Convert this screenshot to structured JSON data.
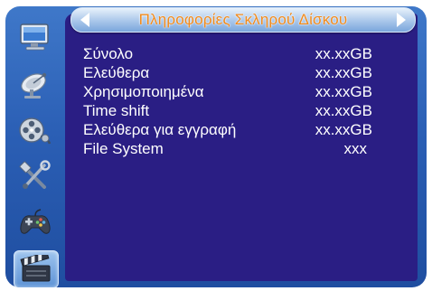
{
  "window": {
    "title": "Πληροφορίες Σκληρού Δίσκου"
  },
  "sidebar": {
    "items": [
      {
        "icon": "computer-monitor-icon",
        "selected": false
      },
      {
        "icon": "satellite-dish-icon",
        "selected": false
      },
      {
        "icon": "film-reel-icon",
        "selected": false
      },
      {
        "icon": "tools-icon",
        "selected": false
      },
      {
        "icon": "gamepad-icon",
        "selected": false
      },
      {
        "icon": "clapperboard-icon",
        "selected": true
      }
    ]
  },
  "info": {
    "rows": [
      {
        "label": "Σύνολο",
        "value": "xx.xxGB"
      },
      {
        "label": "Ελεύθερα",
        "value": "xx.xxGB"
      },
      {
        "label": "Χρησιμοποιημένα",
        "value": "xx.xxGB"
      },
      {
        "label": "Time shift",
        "value": "xx.xxGB"
      },
      {
        "label": "Ελεύθερα για εγγραφή",
        "value": "xx.xxGB"
      },
      {
        "label": "File System",
        "value": "xxx"
      }
    ]
  },
  "colors": {
    "content_background": "#2a1e84",
    "frame_background": "#2b5fb5",
    "title_text": "#f08a1c",
    "row_text": "#ffffff"
  }
}
